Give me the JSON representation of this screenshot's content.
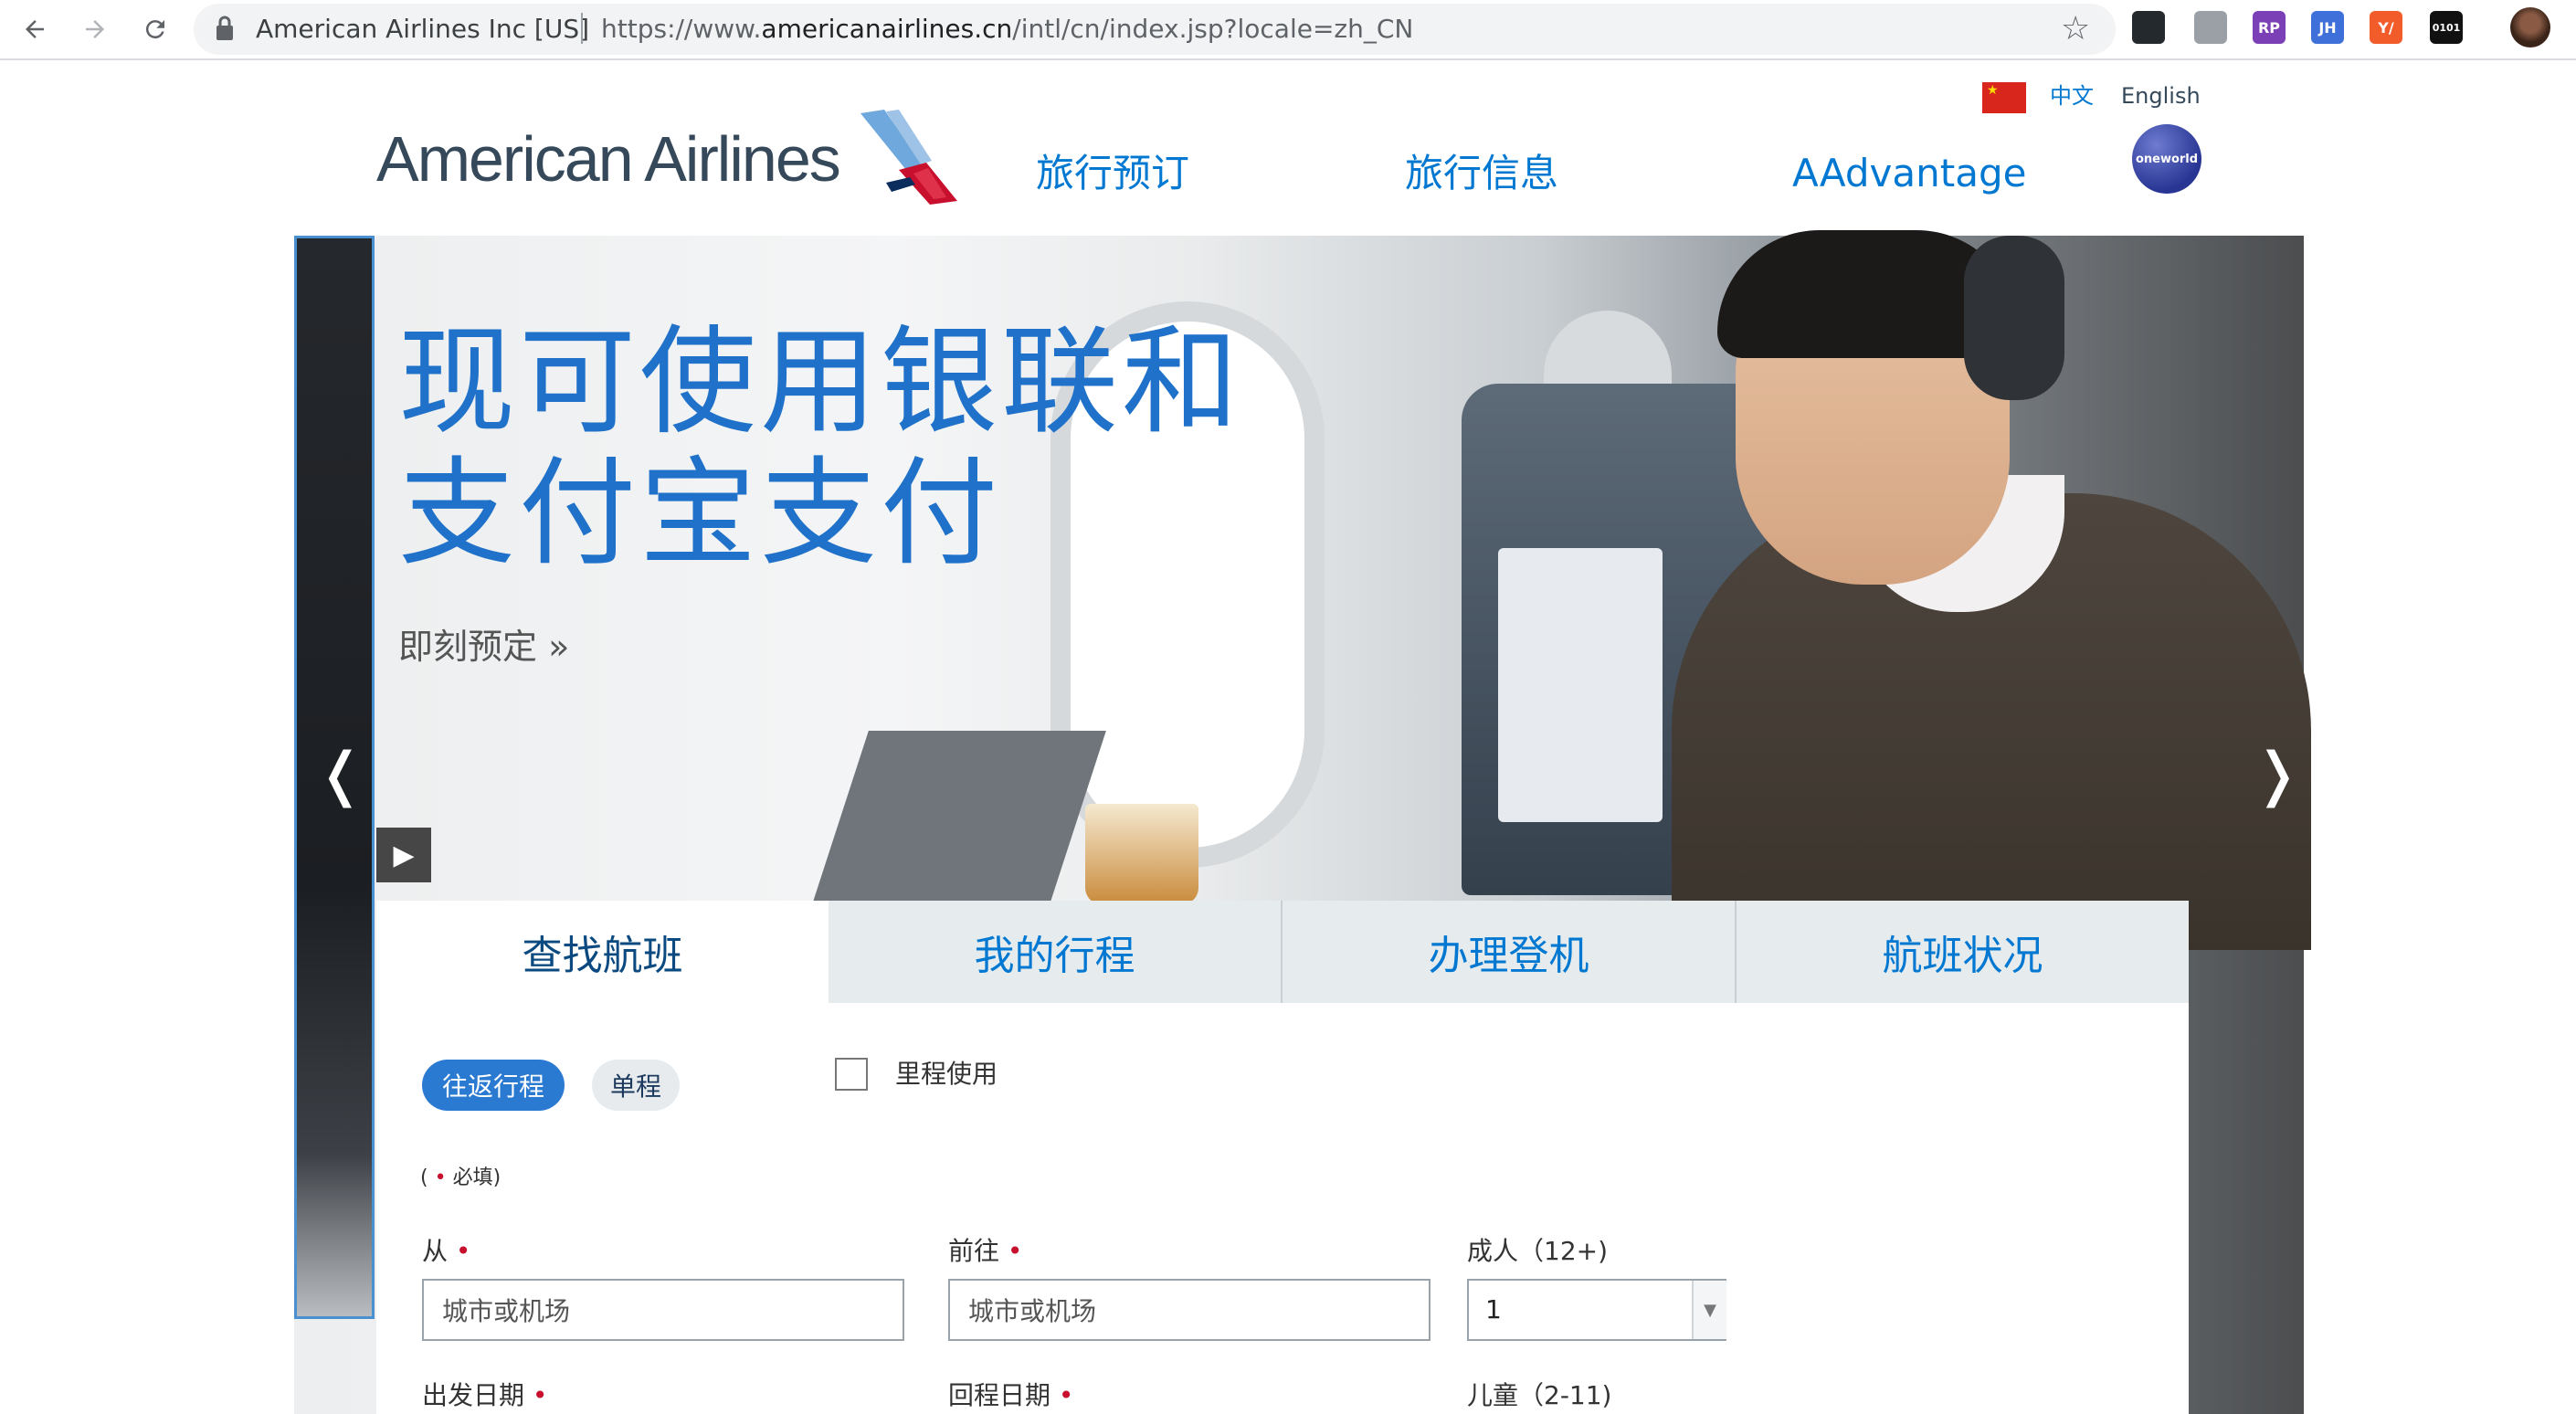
{
  "browser": {
    "nav": {
      "back_icon": "arrow-left-icon",
      "forward_icon": "arrow-right-icon",
      "reload_icon": "reload-icon"
    },
    "site_name": "American Airlines Inc [US]",
    "url_prefix": "https://www.",
    "url_domain": "americanairlines.cn",
    "url_path": "/intl/cn/index.jsp?locale=zh_CN",
    "extensions": [
      {
        "name": "github-icon",
        "glyph": "",
        "color": "#24292e"
      },
      {
        "name": "tree-icon",
        "glyph": "",
        "color": "#9aa0a6"
      },
      {
        "name": "rp-extension-icon",
        "glyph": "RP",
        "color": "#7b3fb6"
      },
      {
        "name": "jh-extension-icon",
        "glyph": "JH",
        "color": "#3f6fd8"
      },
      {
        "name": "translate-extension-icon",
        "glyph": "Y/",
        "color": "#f25c2a"
      },
      {
        "name": "binary-extension-icon",
        "glyph": "0101",
        "color": "#111111"
      }
    ]
  },
  "header": {
    "languages": {
      "zh": "中文",
      "en": "English"
    },
    "logo_text": "American Airlines",
    "nav": [
      "旅行预订",
      "旅行信息",
      "AAdvantage"
    ],
    "oneworld_label": "oneworld"
  },
  "hero": {
    "headline_line1": "现可使用银联和",
    "headline_line2": "支付宝支付",
    "cta": "即刻预定 »"
  },
  "widget": {
    "tabs": [
      "查找航班",
      "我的行程",
      "办理登机",
      "航班状况"
    ],
    "trip_types": {
      "round_trip": "往返行程",
      "one_way": "单程"
    },
    "miles_label": "里程使用",
    "required_note_open": "(",
    "required_note_text": "必填)",
    "from_label": "从",
    "to_label": "前往",
    "city_placeholder": "城市或机场",
    "adults_label": "成人（12+)",
    "adults_value": "1",
    "depart_label": "出发日期",
    "return_label": "回程日期",
    "children_label": "儿童（2-11)"
  },
  "colors": {
    "brand_blue": "#0078d2",
    "headline_blue": "#1f71c9",
    "required_red": "#c8102e",
    "active_pill": "#2a7ad2"
  }
}
